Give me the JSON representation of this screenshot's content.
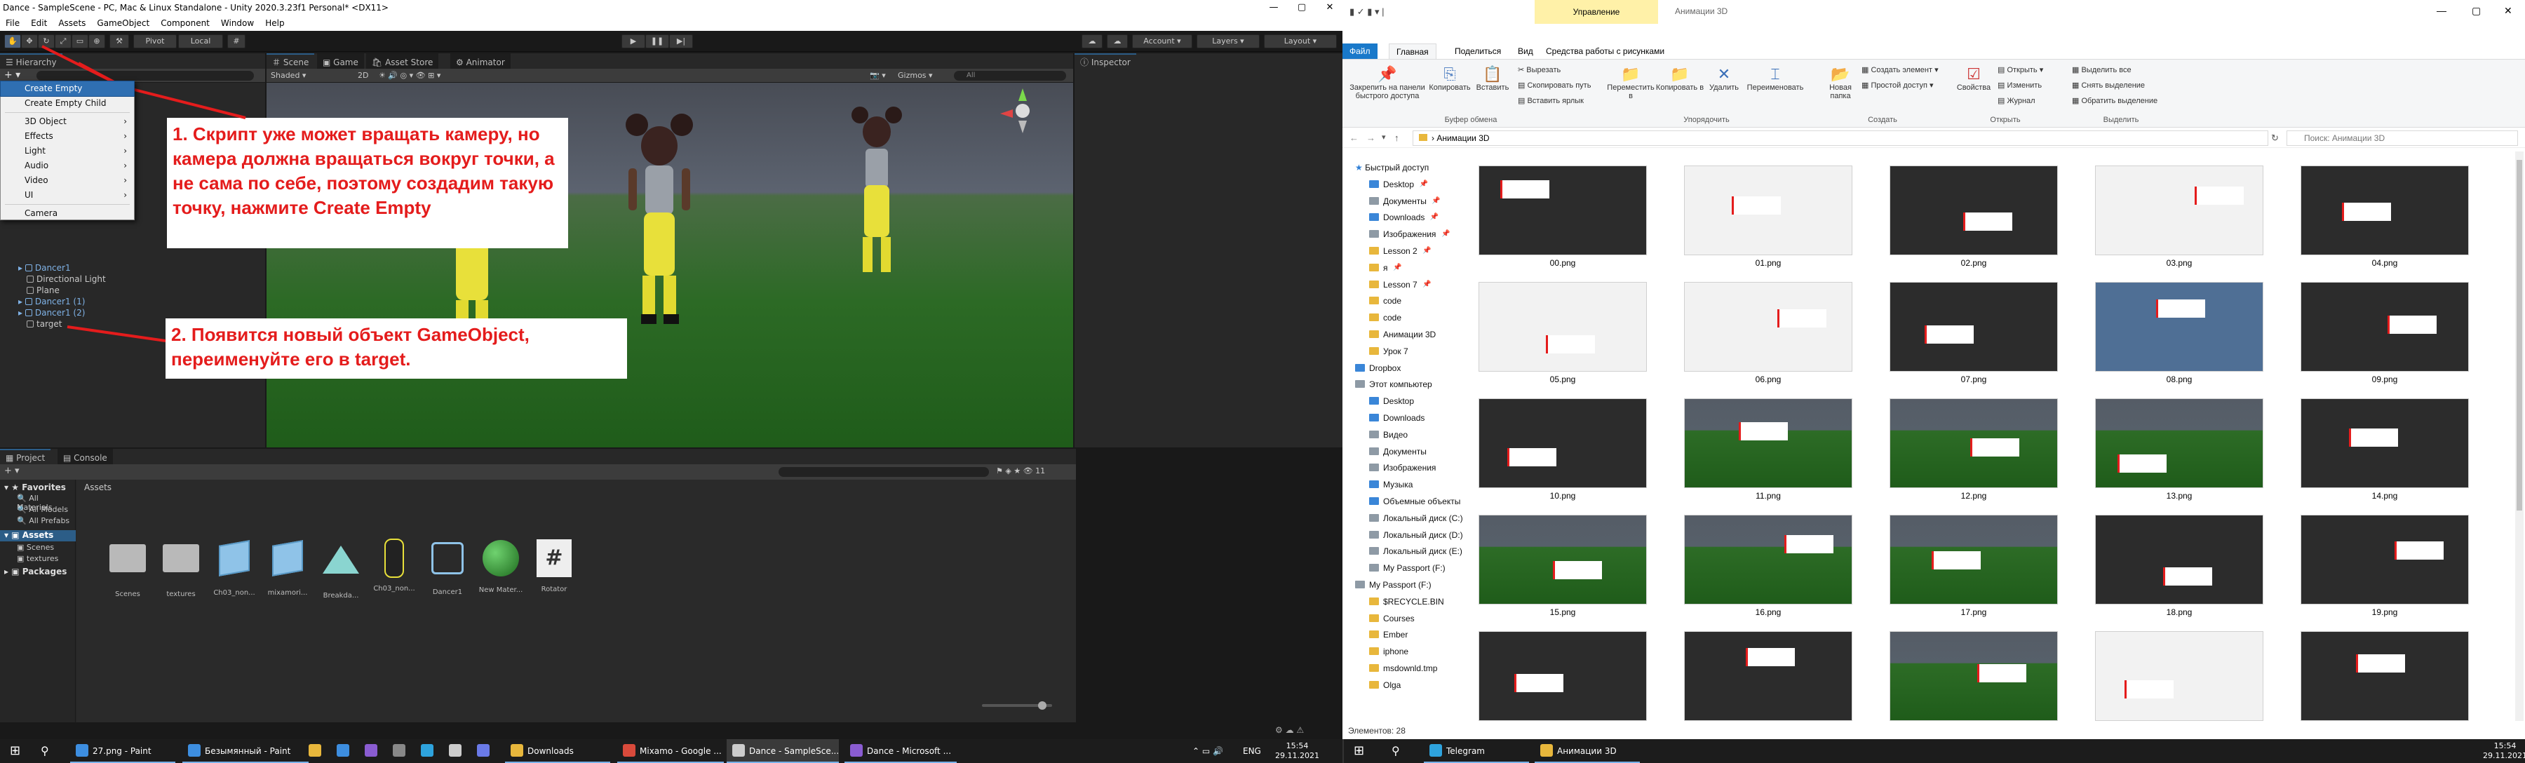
{
  "unity": {
    "title": "Dance - SampleScene - PC, Mac & Linux Standalone - Unity 2020.3.23f1 Personal* <DX11>",
    "menu": [
      "File",
      "Edit",
      "Assets",
      "GameObject",
      "Component",
      "Window",
      "Help"
    ],
    "toolbar": {
      "pivot": "Pivot",
      "local": "Local",
      "account": "Account",
      "layers": "Layers",
      "layout": "Layout"
    },
    "hierarchy": {
      "tab": "Hierarchy",
      "items": [
        {
          "label": "Dancer1",
          "prefab": true
        },
        {
          "label": "Directional Light",
          "prefab": false
        },
        {
          "label": "Plane",
          "prefab": false
        },
        {
          "label": "Dancer1 (1)",
          "prefab": true
        },
        {
          "label": "Dancer1 (2)",
          "prefab": true
        },
        {
          "label": "target",
          "prefab": false
        }
      ]
    },
    "context_menu": [
      {
        "label": "Create Empty",
        "highlighted": true,
        "submenu": false
      },
      {
        "label": "Create Empty Child",
        "highlighted": false,
        "submenu": false
      },
      {
        "label": "3D Object",
        "highlighted": false,
        "submenu": true
      },
      {
        "label": "Effects",
        "highlighted": false,
        "submenu": true
      },
      {
        "label": "Light",
        "highlighted": false,
        "submenu": true
      },
      {
        "label": "Audio",
        "highlighted": false,
        "submenu": true
      },
      {
        "label": "Video",
        "highlighted": false,
        "submenu": true
      },
      {
        "label": "UI",
        "highlighted": false,
        "submenu": true
      },
      {
        "label": "Camera",
        "highlighted": false,
        "submenu": false
      }
    ],
    "scene": {
      "tabs": [
        "Scene",
        "Game",
        "Asset Store",
        "Animator"
      ],
      "shading": "Shaded",
      "mode_2d": "2D",
      "gizmos": "Gizmos",
      "search_placeholder": "All"
    },
    "inspector": {
      "tab": "Inspector"
    },
    "project": {
      "tabs": [
        "Project",
        "Console"
      ],
      "favorites": {
        "label": "Favorites",
        "items": [
          "All Materials",
          "All Models",
          "All Prefabs"
        ]
      },
      "assets_tree": {
        "label": "Assets",
        "items": [
          "Scenes",
          "textures"
        ]
      },
      "packages": "Packages",
      "breadcrumb": "Assets",
      "count": "11",
      "assets": [
        {
          "name": "Scenes",
          "icon": "folder-icon"
        },
        {
          "name": "textures",
          "icon": "folder-icon"
        },
        {
          "name": "Ch03_non...",
          "icon": "model-icon"
        },
        {
          "name": "mixamori...",
          "icon": "model-icon"
        },
        {
          "name": "Breakda...",
          "icon": "anim-icon"
        },
        {
          "name": "Ch03_non...",
          "icon": "char-icon"
        },
        {
          "name": "Dancer1",
          "icon": "prefab-icon"
        },
        {
          "name": "New Mater...",
          "icon": "material-icon"
        },
        {
          "name": "Rotator",
          "icon": "script-icon"
        }
      ]
    },
    "annotations": {
      "a1": "1. Скрипт уже может вращать камеру, но камера должна вращаться вокруг точки, а не сама по себе, поэтому создадим такую точку, нажмите Create Empty",
      "a2": "2. Появится новый объект GameObject, переименуйте его в target."
    }
  },
  "explorer": {
    "title_tab": "Управление",
    "title_folder": "Анимации 3D",
    "ribbon_tabs": [
      "Файл",
      "Главная",
      "Поделиться",
      "Вид",
      "Средства работы с рисунками"
    ],
    "ribbon": {
      "pin": "Закрепить на панели быстрого доступа",
      "copy": "Копировать",
      "paste": "Вставить",
      "cut": "Вырезать",
      "copy_path": "Скопировать путь",
      "paste_shortcut": "Вставить ярлык",
      "clipboard_group": "Буфер обмена",
      "move": "Переместить в",
      "copy_to": "Копировать в",
      "delete": "Удалить",
      "rename": "Переименовать",
      "organize_group": "Упорядочить",
      "new_folder": "Новая папка",
      "new_item": "Создать элемент",
      "easy_access": "Простой доступ",
      "new_group": "Создать",
      "properties": "Свойства",
      "open": "Открыть",
      "edit": "Изменить",
      "history": "Журнал",
      "open_group": "Открыть",
      "select_all": "Выделить все",
      "select_none": "Снять выделение",
      "invert": "Обратить выделение",
      "select_group": "Выделить"
    },
    "address": "Анимации 3D",
    "search_placeholder": "Поиск: Анимации 3D",
    "nav": [
      {
        "label": "Быстрый доступ",
        "icon": "star-icon",
        "indent": 0,
        "pin": false
      },
      {
        "label": "Desktop",
        "icon": "blue",
        "indent": 1,
        "pin": true
      },
      {
        "label": "Документы",
        "icon": "grey",
        "indent": 1,
        "pin": true
      },
      {
        "label": "Downloads",
        "icon": "blue",
        "indent": 1,
        "pin": true
      },
      {
        "label": "Изображения",
        "icon": "grey",
        "indent": 1,
        "pin": true
      },
      {
        "label": "Lesson 2",
        "icon": "yellow",
        "indent": 1,
        "pin": true
      },
      {
        "label": "я",
        "icon": "yellow",
        "indent": 1,
        "pin": true
      },
      {
        "label": "Lesson 7",
        "icon": "yellow",
        "indent": 1,
        "pin": true
      },
      {
        "label": "code",
        "icon": "yellow",
        "indent": 1,
        "pin": false
      },
      {
        "label": "code",
        "icon": "yellow",
        "indent": 1,
        "pin": false
      },
      {
        "label": "Анимации 3D",
        "icon": "yellow",
        "indent": 1,
        "pin": false
      },
      {
        "label": "Урок 7",
        "icon": "yellow",
        "indent": 1,
        "pin": false
      },
      {
        "label": "Dropbox",
        "icon": "blue",
        "indent": 0,
        "pin": false
      },
      {
        "label": "Этот компьютер",
        "icon": "grey",
        "indent": 0,
        "pin": false
      },
      {
        "label": "Desktop",
        "icon": "blue",
        "indent": 1,
        "pin": false
      },
      {
        "label": "Downloads",
        "icon": "blue",
        "indent": 1,
        "pin": false
      },
      {
        "label": "Видео",
        "icon": "grey",
        "indent": 1,
        "pin": false
      },
      {
        "label": "Документы",
        "icon": "grey",
        "indent": 1,
        "pin": false
      },
      {
        "label": "Изображения",
        "icon": "grey",
        "indent": 1,
        "pin": false
      },
      {
        "label": "Музыка",
        "icon": "blue",
        "indent": 1,
        "pin": false
      },
      {
        "label": "Объемные объекты",
        "icon": "blue",
        "indent": 1,
        "pin": false
      },
      {
        "label": "Локальный диск (C:)",
        "icon": "grey",
        "indent": 1,
        "pin": false
      },
      {
        "label": "Локальный диск (D:)",
        "icon": "grey",
        "indent": 1,
        "pin": false
      },
      {
        "label": "Локальный диск (E:)",
        "icon": "grey",
        "indent": 1,
        "pin": false
      },
      {
        "label": "My Passport (F:)",
        "icon": "grey",
        "indent": 1,
        "pin": false
      },
      {
        "label": "My Passport (F:)",
        "icon": "grey",
        "indent": 0,
        "pin": false
      },
      {
        "label": "$RECYCLE.BIN",
        "icon": "yellow",
        "indent": 1,
        "pin": false
      },
      {
        "label": "Courses",
        "icon": "yellow",
        "indent": 1,
        "pin": false
      },
      {
        "label": "Ember",
        "icon": "yellow",
        "indent": 1,
        "pin": false
      },
      {
        "label": "iphone",
        "icon": "yellow",
        "indent": 1,
        "pin": false
      },
      {
        "label": "msdownld.tmp",
        "icon": "yellow",
        "indent": 1,
        "pin": false
      },
      {
        "label": "Olga",
        "icon": "yellow",
        "indent": 1,
        "pin": false
      }
    ],
    "files": [
      "00.png",
      "01.png",
      "02.png",
      "03.png",
      "04.png",
      "05.png",
      "06.png",
      "07.png",
      "08.png",
      "09.png",
      "10.png",
      "11.png",
      "12.png",
      "13.png",
      "14.png",
      "15.png",
      "16.png",
      "17.png",
      "18.png",
      "19.png",
      "",
      "",
      "",
      "",
      ""
    ],
    "status": "Элементов: 28"
  },
  "taskbar": {
    "items_left": [
      {
        "label": "27.png - Paint",
        "color": "#3d8ee0"
      },
      {
        "label": "Безымянный - Paint",
        "color": "#3d8ee0"
      },
      {
        "label": "Downloads",
        "color": "#e8b73c"
      },
      {
        "label": "Mixamo - Google ...",
        "color": "#d94a3b"
      },
      {
        "label": "Dance - SampleSce...",
        "color": "#cccccc"
      },
      {
        "label": "Dance - Microsoft ...",
        "color": "#8a5cd1"
      }
    ],
    "lang": "ENG",
    "time": "15:54",
    "date": "29.11.2021",
    "items_right": [
      {
        "label": "Telegram",
        "color": "#2ea3dd"
      },
      {
        "label": "Анимации 3D",
        "color": "#e8b73c"
      }
    ],
    "time2": "15:54",
    "date2": "29.11.2021"
  }
}
